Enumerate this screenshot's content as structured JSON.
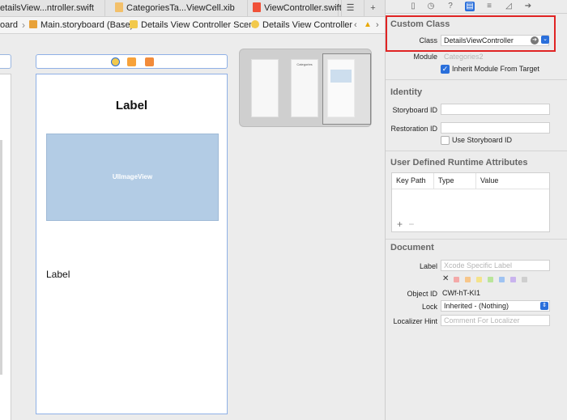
{
  "tabs": [
    {
      "label": "etailsView...ntroller.swift",
      "icon": "swift-file-icon",
      "color": "#f05138"
    },
    {
      "label": "CategoriesTa...ViewCell.xib",
      "icon": "xib-file-icon",
      "color": "#f0a030"
    },
    {
      "label": "ViewController.swift",
      "icon": "swift-file-icon",
      "color": "#f05138"
    }
  ],
  "breadcrumbs": [
    {
      "label": "oard",
      "icon": ""
    },
    {
      "label": "Main.storyboard (Base)",
      "icon": "storyboard-icon"
    },
    {
      "label": "Details View Controller Scene",
      "icon": "scene-icon"
    },
    {
      "label": "Details View Controller",
      "icon": "view-controller-icon"
    }
  ],
  "canvas": {
    "label_top": "Label",
    "image_view": "UIImageView",
    "label_bottom": "Label",
    "minimap_categories": "Categories"
  },
  "inspector": {
    "custom_class": {
      "title": "Custom Class",
      "class_label": "Class",
      "class_value": "DetailsViewController",
      "module_label": "Module",
      "module_placeholder": "Categories2",
      "inherit_label": "Inherit Module From Target",
      "inherit_checked": true
    },
    "identity": {
      "title": "Identity",
      "storyboard_id_label": "Storyboard ID",
      "restoration_id_label": "Restoration ID",
      "use_storyboard_id_label": "Use Storyboard ID",
      "use_storyboard_id_checked": false
    },
    "runtime_attributes": {
      "title": "User Defined Runtime Attributes",
      "columns": [
        "Key Path",
        "Type",
        "Value"
      ],
      "add": "+",
      "remove": "−"
    },
    "document": {
      "title": "Document",
      "label_label": "Label",
      "label_placeholder": "Xcode Specific Label",
      "clear": "✕",
      "swatches": [
        "#f4a9a8",
        "#f7c68a",
        "#f4e38b",
        "#b9e59a",
        "#9fc3f2",
        "#c9b3ee",
        "#cfcfcf"
      ],
      "object_id_label": "Object ID",
      "object_id_value": "CWf-hT-KI1",
      "lock_label": "Lock",
      "lock_value": "Inherited - (Nothing)",
      "localizer_label": "Localizer Hint",
      "localizer_placeholder": "Comment For Localizer"
    }
  },
  "colors": {
    "accent": "#2a6fdb",
    "highlight": "#e02424",
    "image_view": "#b3cce5"
  }
}
